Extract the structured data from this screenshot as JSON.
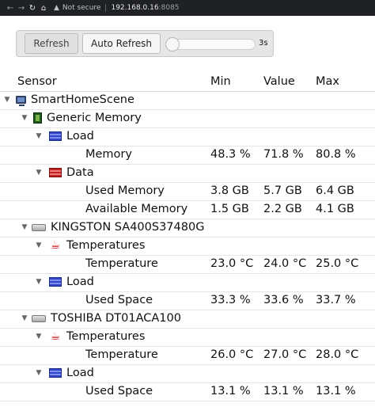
{
  "browser": {
    "security_label": "Not secure",
    "url_host": "192.168.0.16",
    "url_port": ":8085"
  },
  "toolbar": {
    "refresh_label": "Refresh",
    "auto_refresh_label": "Auto Refresh",
    "interval_label": "3s"
  },
  "table": {
    "headers": {
      "sensor": "Sensor",
      "min": "Min",
      "value": "Value",
      "max": "Max"
    },
    "rows": [
      {
        "name": "SmartHomeScene",
        "icon": "computer-icon"
      },
      {
        "name": "Generic Memory",
        "icon": "memory-icon"
      },
      {
        "name": "Load",
        "icon": "load-icon"
      },
      {
        "name": "Memory",
        "min": "48.3 %",
        "value": "71.8 %",
        "max": "80.8 %"
      },
      {
        "name": "Data",
        "icon": "data-icon"
      },
      {
        "name": "Used Memory",
        "min": "3.8 GB",
        "value": "5.7 GB",
        "max": "6.4 GB"
      },
      {
        "name": "Available Memory",
        "min": "1.5 GB",
        "value": "2.2 GB",
        "max": "4.1 GB"
      },
      {
        "name": "KINGSTON SA400S37480G",
        "icon": "hdd-icon"
      },
      {
        "name": "Temperatures",
        "icon": "thermometer-icon"
      },
      {
        "name": "Temperature",
        "min": "23.0 °C",
        "value": "24.0 °C",
        "max": "25.0 °C"
      },
      {
        "name": "Load",
        "icon": "load-icon"
      },
      {
        "name": "Used Space",
        "min": "33.3 %",
        "value": "33.6 %",
        "max": "33.7 %"
      },
      {
        "name": "TOSHIBA DT01ACA100",
        "icon": "hdd-icon"
      },
      {
        "name": "Temperatures",
        "icon": "thermometer-icon"
      },
      {
        "name": "Temperature",
        "min": "26.0 °C",
        "value": "27.0 °C",
        "max": "28.0 °C"
      },
      {
        "name": "Load",
        "icon": "load-icon"
      },
      {
        "name": "Used Space",
        "min": "13.1 %",
        "value": "13.1 %",
        "max": "13.1 %"
      }
    ]
  }
}
